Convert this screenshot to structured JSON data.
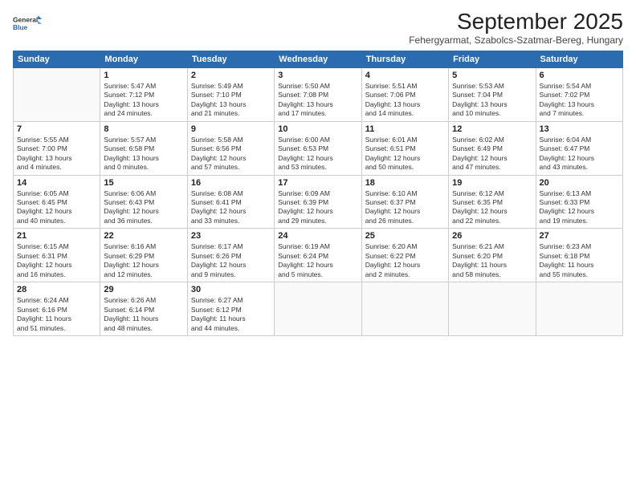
{
  "logo": {
    "general": "General",
    "blue": "Blue"
  },
  "header": {
    "month": "September 2025",
    "location": "Fehergyarmat, Szabolcs-Szatmar-Bereg, Hungary"
  },
  "weekdays": [
    "Sunday",
    "Monday",
    "Tuesday",
    "Wednesday",
    "Thursday",
    "Friday",
    "Saturday"
  ],
  "weeks": [
    [
      {
        "num": "",
        "info": ""
      },
      {
        "num": "1",
        "info": "Sunrise: 5:47 AM\nSunset: 7:12 PM\nDaylight: 13 hours\nand 24 minutes."
      },
      {
        "num": "2",
        "info": "Sunrise: 5:49 AM\nSunset: 7:10 PM\nDaylight: 13 hours\nand 21 minutes."
      },
      {
        "num": "3",
        "info": "Sunrise: 5:50 AM\nSunset: 7:08 PM\nDaylight: 13 hours\nand 17 minutes."
      },
      {
        "num": "4",
        "info": "Sunrise: 5:51 AM\nSunset: 7:06 PM\nDaylight: 13 hours\nand 14 minutes."
      },
      {
        "num": "5",
        "info": "Sunrise: 5:53 AM\nSunset: 7:04 PM\nDaylight: 13 hours\nand 10 minutes."
      },
      {
        "num": "6",
        "info": "Sunrise: 5:54 AM\nSunset: 7:02 PM\nDaylight: 13 hours\nand 7 minutes."
      }
    ],
    [
      {
        "num": "7",
        "info": "Sunrise: 5:55 AM\nSunset: 7:00 PM\nDaylight: 13 hours\nand 4 minutes."
      },
      {
        "num": "8",
        "info": "Sunrise: 5:57 AM\nSunset: 6:58 PM\nDaylight: 13 hours\nand 0 minutes."
      },
      {
        "num": "9",
        "info": "Sunrise: 5:58 AM\nSunset: 6:56 PM\nDaylight: 12 hours\nand 57 minutes."
      },
      {
        "num": "10",
        "info": "Sunrise: 6:00 AM\nSunset: 6:53 PM\nDaylight: 12 hours\nand 53 minutes."
      },
      {
        "num": "11",
        "info": "Sunrise: 6:01 AM\nSunset: 6:51 PM\nDaylight: 12 hours\nand 50 minutes."
      },
      {
        "num": "12",
        "info": "Sunrise: 6:02 AM\nSunset: 6:49 PM\nDaylight: 12 hours\nand 47 minutes."
      },
      {
        "num": "13",
        "info": "Sunrise: 6:04 AM\nSunset: 6:47 PM\nDaylight: 12 hours\nand 43 minutes."
      }
    ],
    [
      {
        "num": "14",
        "info": "Sunrise: 6:05 AM\nSunset: 6:45 PM\nDaylight: 12 hours\nand 40 minutes."
      },
      {
        "num": "15",
        "info": "Sunrise: 6:06 AM\nSunset: 6:43 PM\nDaylight: 12 hours\nand 36 minutes."
      },
      {
        "num": "16",
        "info": "Sunrise: 6:08 AM\nSunset: 6:41 PM\nDaylight: 12 hours\nand 33 minutes."
      },
      {
        "num": "17",
        "info": "Sunrise: 6:09 AM\nSunset: 6:39 PM\nDaylight: 12 hours\nand 29 minutes."
      },
      {
        "num": "18",
        "info": "Sunrise: 6:10 AM\nSunset: 6:37 PM\nDaylight: 12 hours\nand 26 minutes."
      },
      {
        "num": "19",
        "info": "Sunrise: 6:12 AM\nSunset: 6:35 PM\nDaylight: 12 hours\nand 22 minutes."
      },
      {
        "num": "20",
        "info": "Sunrise: 6:13 AM\nSunset: 6:33 PM\nDaylight: 12 hours\nand 19 minutes."
      }
    ],
    [
      {
        "num": "21",
        "info": "Sunrise: 6:15 AM\nSunset: 6:31 PM\nDaylight: 12 hours\nand 16 minutes."
      },
      {
        "num": "22",
        "info": "Sunrise: 6:16 AM\nSunset: 6:29 PM\nDaylight: 12 hours\nand 12 minutes."
      },
      {
        "num": "23",
        "info": "Sunrise: 6:17 AM\nSunset: 6:26 PM\nDaylight: 12 hours\nand 9 minutes."
      },
      {
        "num": "24",
        "info": "Sunrise: 6:19 AM\nSunset: 6:24 PM\nDaylight: 12 hours\nand 5 minutes."
      },
      {
        "num": "25",
        "info": "Sunrise: 6:20 AM\nSunset: 6:22 PM\nDaylight: 12 hours\nand 2 minutes."
      },
      {
        "num": "26",
        "info": "Sunrise: 6:21 AM\nSunset: 6:20 PM\nDaylight: 11 hours\nand 58 minutes."
      },
      {
        "num": "27",
        "info": "Sunrise: 6:23 AM\nSunset: 6:18 PM\nDaylight: 11 hours\nand 55 minutes."
      }
    ],
    [
      {
        "num": "28",
        "info": "Sunrise: 6:24 AM\nSunset: 6:16 PM\nDaylight: 11 hours\nand 51 minutes."
      },
      {
        "num": "29",
        "info": "Sunrise: 6:26 AM\nSunset: 6:14 PM\nDaylight: 11 hours\nand 48 minutes."
      },
      {
        "num": "30",
        "info": "Sunrise: 6:27 AM\nSunset: 6:12 PM\nDaylight: 11 hours\nand 44 minutes."
      },
      {
        "num": "",
        "info": ""
      },
      {
        "num": "",
        "info": ""
      },
      {
        "num": "",
        "info": ""
      },
      {
        "num": "",
        "info": ""
      }
    ]
  ]
}
